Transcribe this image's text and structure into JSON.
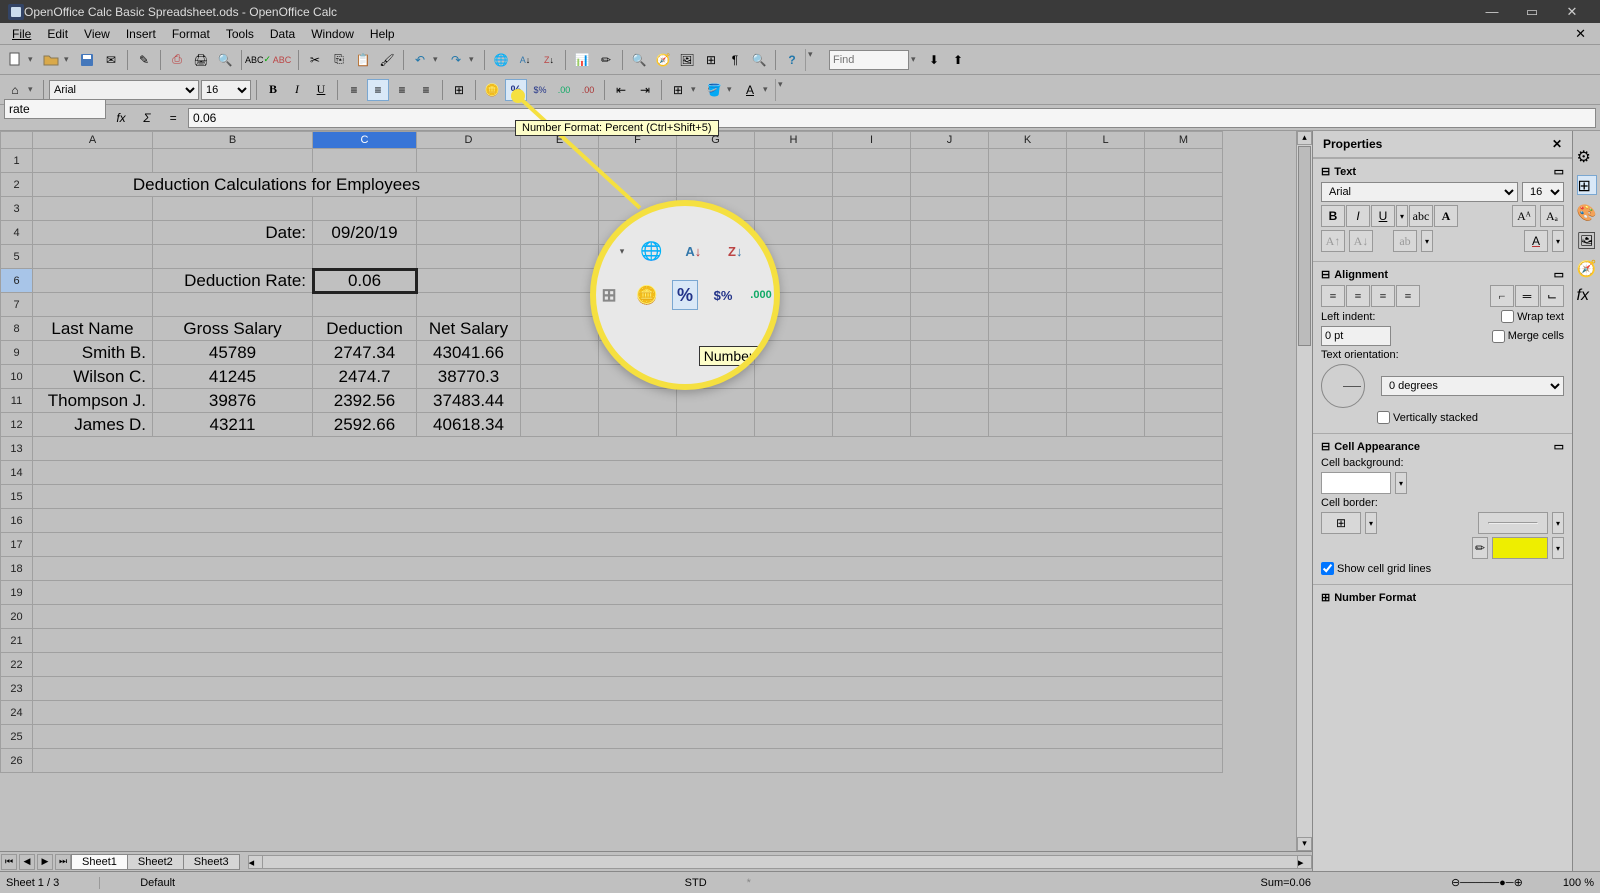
{
  "window": {
    "title": "OpenOffice Calc Basic Spreadsheet.ods - OpenOffice Calc"
  },
  "menu": {
    "file": "File",
    "edit": "Edit",
    "view": "View",
    "insert": "Insert",
    "format": "Format",
    "tools": "Tools",
    "data": "Data",
    "window": "Window",
    "help": "Help"
  },
  "find": {
    "placeholder": "Find"
  },
  "fontbar": {
    "font": "Arial",
    "size": "16"
  },
  "formulaBar": {
    "nameBox": "rate",
    "formula": "0.06"
  },
  "tooltip": {
    "percent": "Number Format: Percent (Ctrl+Shift+5)"
  },
  "zoom": {
    "tooltip": "Number F"
  },
  "columns": [
    "A",
    "B",
    "C",
    "D",
    "E",
    "F",
    "G",
    "H",
    "I",
    "J",
    "K",
    "L",
    "M"
  ],
  "sheet": {
    "title": "Deduction Calculations for Employees",
    "dateLabel": "Date:",
    "date": "09/20/19",
    "rateLabel": "Deduction Rate:",
    "rate": "0.06",
    "headers": {
      "a": "Last Name",
      "b": "Gross Salary",
      "c": "Deduction",
      "d": "Net Salary"
    },
    "rows": [
      {
        "a": "Smith B.",
        "b": "45789",
        "c": "2747.34",
        "d": "43041.66"
      },
      {
        "a": "Wilson C.",
        "b": "41245",
        "c": "2474.7",
        "d": "38770.3"
      },
      {
        "a": "Thompson J.",
        "b": "39876",
        "c": "2392.56",
        "d": "37483.44"
      },
      {
        "a": "James D.",
        "b": "43211",
        "c": "2592.66",
        "d": "40618.34"
      }
    ]
  },
  "tabs": {
    "s1": "Sheet1",
    "s2": "Sheet2",
    "s3": "Sheet3"
  },
  "status": {
    "sheet": "Sheet 1 / 3",
    "style": "Default",
    "mode": "STD",
    "sum": "Sum=0.06",
    "zoom": "100 %"
  },
  "props": {
    "title": "Properties",
    "text": "Text",
    "alignment": "Alignment",
    "cellApp": "Cell Appearance",
    "numFormat": "Number Format",
    "font": "Arial",
    "size": "16",
    "leftIndent": "Left indent:",
    "indentVal": "0 pt",
    "wrap": "Wrap text",
    "merge": "Merge cells",
    "orientLabel": "Text orientation:",
    "orientVal": "0 degrees",
    "vert": "Vertically stacked",
    "cellBg": "Cell background:",
    "cellBorder": "Cell border:",
    "gridLines": "Show cell grid lines"
  }
}
